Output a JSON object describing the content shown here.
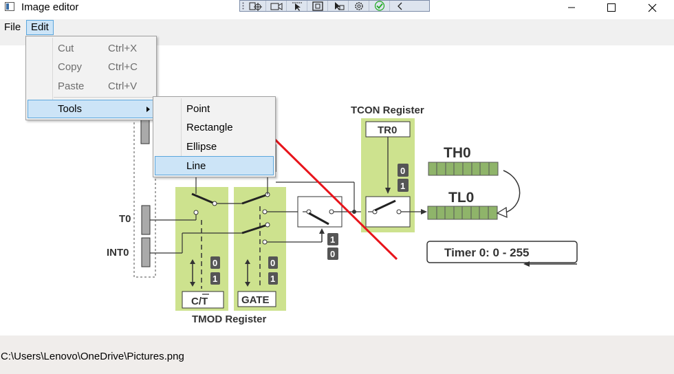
{
  "window": {
    "title": "Image editor",
    "controls": [
      "minimize",
      "maximize",
      "close"
    ]
  },
  "toolbar": {
    "icons": [
      "point-tool-icon",
      "camera-icon",
      "select-arrow-icon",
      "rectangle-tool-icon",
      "pointer-tool-icon",
      "settings-icon",
      "check-icon",
      "back-arrow-icon"
    ],
    "accent_check": "#1faa1f"
  },
  "menubar": {
    "items": [
      {
        "label": "File",
        "active": false
      },
      {
        "label": "Edit",
        "active": true
      }
    ]
  },
  "edit_menu": {
    "items": [
      {
        "label": "Cut",
        "shortcut": "Ctrl+X",
        "enabled": false
      },
      {
        "label": "Copy",
        "shortcut": "Ctrl+C",
        "enabled": false
      },
      {
        "label": "Paste",
        "shortcut": "Ctrl+V",
        "enabled": false
      },
      {
        "label": "Tools",
        "shortcut": "",
        "enabled": true,
        "has_submenu": true
      }
    ]
  },
  "tools_submenu": {
    "items": [
      {
        "label": "Point",
        "highlighted": false
      },
      {
        "label": "Rectangle",
        "highlighted": false
      },
      {
        "label": "Ellipse",
        "highlighted": false
      },
      {
        "label": "Line",
        "highlighted": true
      }
    ]
  },
  "image": {
    "labels": {
      "tcon": "TCON Register",
      "tr0": "TR0",
      "th0": "TH0",
      "tl0": "TL0",
      "t0": "T0",
      "int0": "INT0",
      "ct": "C/T",
      "gate": "GATE",
      "tmod": "TMOD Register",
      "timer": "Timer 0: 0 - 255",
      "zero": "0",
      "one": "1"
    },
    "colors": {
      "register_fill": "#cde28e",
      "drawn_line": "#e8141b",
      "bit_block": "#8fb46a"
    }
  },
  "status": {
    "path": "C:\\Users\\Lenovo\\OneDrive\\Pictures.png"
  }
}
